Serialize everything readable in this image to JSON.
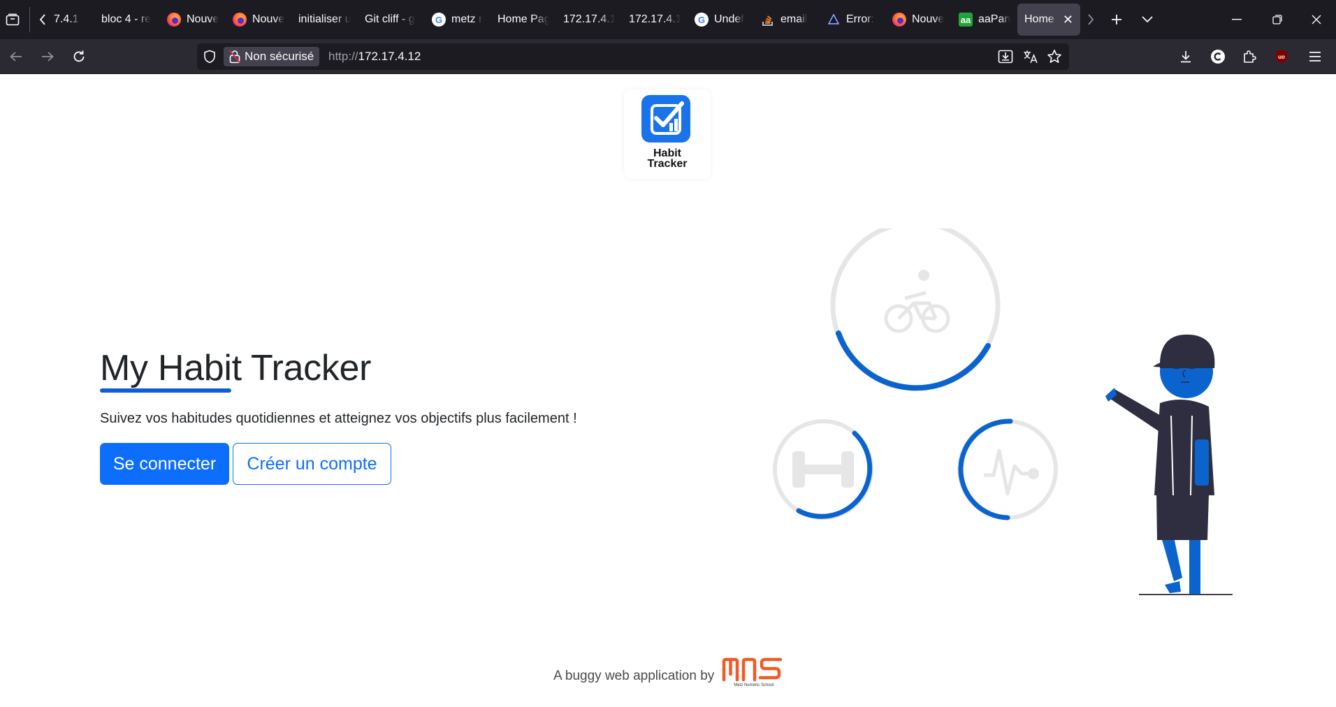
{
  "browser": {
    "tabs": [
      {
        "title": "7.4.1",
        "favicon": "none"
      },
      {
        "title": "bloc 4 - re",
        "favicon": "none"
      },
      {
        "title": "Nouve",
        "favicon": "firefox-icon"
      },
      {
        "title": "Nouve",
        "favicon": "firefox-icon"
      },
      {
        "title": "initialiser u",
        "favicon": "none"
      },
      {
        "title": "Git cliff - g",
        "favicon": "none"
      },
      {
        "title": "metz r",
        "favicon": "google-icon"
      },
      {
        "title": "Home Pag",
        "favicon": "none"
      },
      {
        "title": "172.17.4.1",
        "favicon": "none"
      },
      {
        "title": "172.17.4.1",
        "favicon": "none"
      },
      {
        "title": "Undef",
        "favicon": "google-icon"
      },
      {
        "title": "email",
        "favicon": "stackoverflow-icon"
      },
      {
        "title": "Error:",
        "favicon": "triangle-icon"
      },
      {
        "title": "Nouve",
        "favicon": "firefox-icon"
      },
      {
        "title": "aaPan",
        "favicon": "aapanel-icon"
      },
      {
        "title": "Home P",
        "favicon": "none",
        "active": true
      }
    ],
    "security_label": "Non sécurisé",
    "url_scheme": "http://",
    "url_host": "172.17.4.12"
  },
  "page": {
    "logo_line1": "Habit",
    "logo_line2": "Tracker",
    "headline": "My Habit Tracker",
    "subtitle": "Suivez vos habitudes quotidiennes et atteignez vos objectifs plus facilement !",
    "login_button": "Se connecter",
    "signup_button": "Créer un compte",
    "footer_text": "A buggy web application by",
    "footer_brand": "MNS",
    "footer_brand_sub": "Metz Numeric School"
  },
  "colors": {
    "accent": "#0d6efd",
    "illustration_blue": "#0b63ce",
    "illustration_gray": "#e6e6e6",
    "person_dark": "#2f2e41",
    "brand_orange": "#f15a24"
  }
}
